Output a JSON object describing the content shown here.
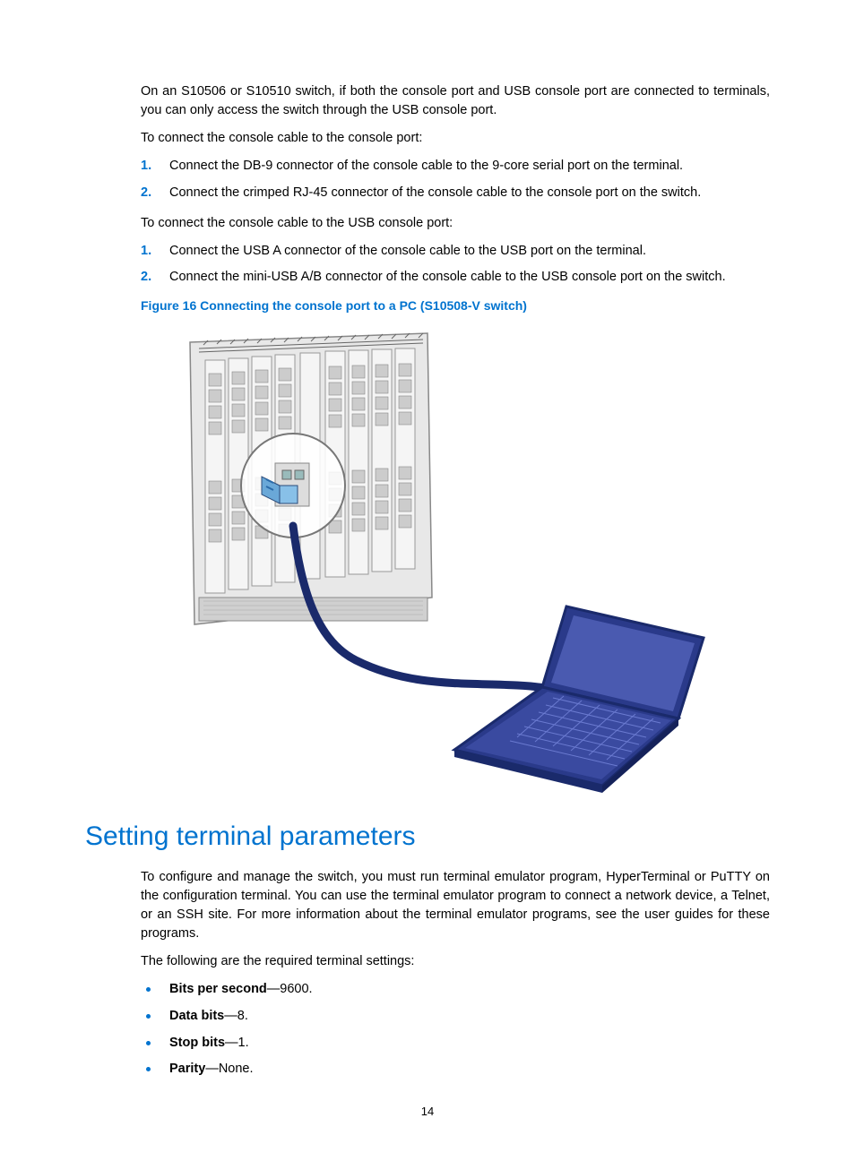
{
  "intro": "On an S10506 or S10510 switch, if both the console port and USB console port are connected to terminals, you can only access the switch through the USB console port.",
  "lead1": "To connect the console cable to the console port:",
  "steps1": [
    "Connect the DB-9 connector of the console cable to the 9-core serial port on the terminal.",
    "Connect the crimped RJ-45 connector of the console cable to the console port on the switch."
  ],
  "lead2": "To connect the console cable to the USB console port:",
  "steps2": [
    "Connect the USB A connector of the console cable to the USB port on the terminal.",
    "Connect the mini-USB A/B connector of the console cable to the USB console port on the switch."
  ],
  "figCaption": "Figure 16 Connecting the console port to a PC (S10508-V switch)",
  "h2": "Setting terminal parameters",
  "para2": "To configure and manage the switch, you must run terminal emulator program, HyperTerminal or PuTTY on the configuration terminal. You can use the terminal emulator program to connect a network device, a Telnet, or an SSH site. For more information about the terminal emulator programs, see the user guides for these programs.",
  "lead3": "The following are the required terminal settings:",
  "settings": [
    {
      "label": "Bits per second",
      "value": "—9600."
    },
    {
      "label": "Data bits",
      "value": "—8."
    },
    {
      "label": "Stop bits",
      "value": "—1."
    },
    {
      "label": "Parity",
      "value": "—None."
    }
  ],
  "pageNum": "14",
  "nums": {
    "n1": "1.",
    "n2": "2."
  }
}
